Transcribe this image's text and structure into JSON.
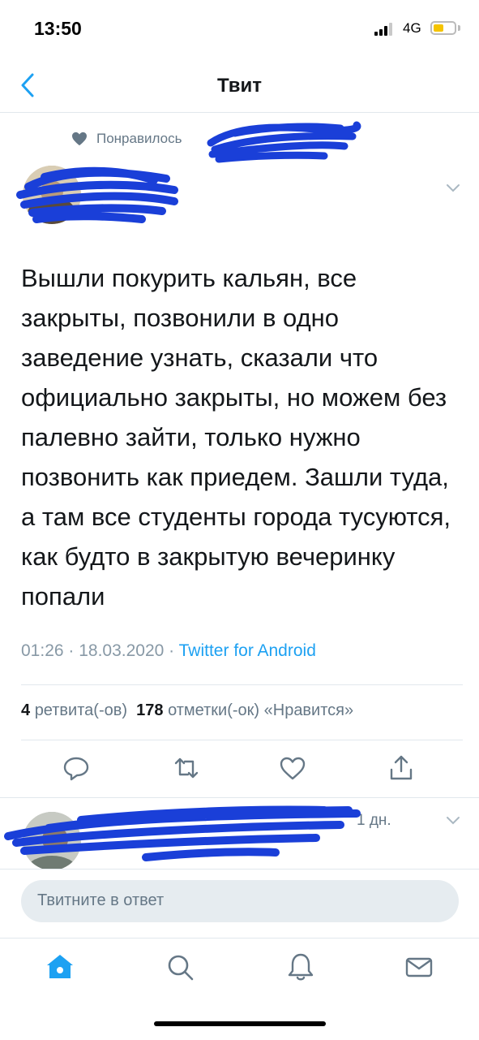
{
  "status_bar": {
    "time": "13:50",
    "network": "4G"
  },
  "nav": {
    "title": "Твит"
  },
  "liked_banner": {
    "text": "Понравилось"
  },
  "tweet": {
    "text": "Вышли покурить кальян, все закрыты, позвонили в одно заведение узнать, сказали что официально закрыты, но можем без палевно зайти, только нужно позвонить как приедем. Зашли туда, а там все студенты города тусуются, как будто в закрытую вечеринку попали",
    "time": "01:26",
    "date": "18.03.2020",
    "source": "Twitter for Android"
  },
  "stats": {
    "retweets_count": "4",
    "retweets_label": "ретвита(-ов)",
    "likes_count": "178",
    "likes_label": "отметки(-ок) «Нравится»"
  },
  "actions": [
    "reply-icon",
    "retweet-icon",
    "like-icon",
    "share-icon"
  ],
  "reply_preview": {
    "time": "1 дн."
  },
  "compose": {
    "placeholder": "Твитните в ответ"
  },
  "tab_bar": [
    "home-icon",
    "search-icon",
    "notifications-icon",
    "messages-icon"
  ],
  "colors": {
    "accent": "#1da1f2",
    "secondary_text": "#657786",
    "redaction": "#1a3fd8",
    "divider": "#e1e8ed"
  }
}
